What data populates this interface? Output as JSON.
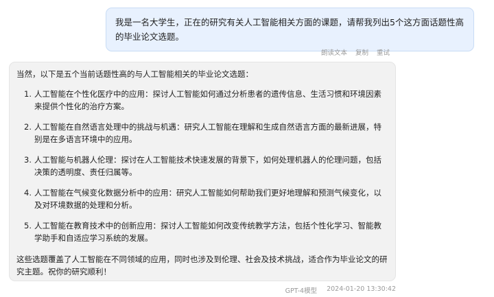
{
  "user_message": {
    "text": "我是一名大学生，正在的研究有关人工智能相关方面的课题，请帮我列出5个这方面话题性高的毕业论文选题。",
    "actions": [
      "朗读文本",
      "复制",
      "重试"
    ]
  },
  "ai_message": {
    "intro": "当然，以下是五个当前话题性高的与人工智能相关的毕业论文选题：",
    "items": [
      {
        "num": "1.",
        "text": "人工智能在个性化医疗中的应用：探讨人工智能如何通过分析患者的遗传信息、生活习惯和环境因素来提供个性化的治疗方案。"
      },
      {
        "num": "2.",
        "text": "人工智能在自然语言处理中的挑战与机遇：研究人工智能在理解和生成自然语言方面的最新进展，特别是在多语言环境中的应用。"
      },
      {
        "num": "3.",
        "text": "人工智能与机器人伦理：探讨在人工智能技术快速发展的背景下，如何处理机器人的伦理问题，包括决策的透明度、责任归属等。"
      },
      {
        "num": "4.",
        "text": "人工智能在气候变化数据分析中的应用：研究人工智能如何帮助我们更好地理解和预测气候变化，以及对环境数据的处理和分析。"
      },
      {
        "num": "5.",
        "text": "人工智能在教育技术中的创新应用：探讨人工智能如何改变传统教学方法，包括个性化学习、智能教学助手和自适应学习系统的发展。"
      }
    ],
    "outro": "这些选题覆盖了人工智能在不同领域的应用，同时也涉及到伦理、社会及技术挑战，适合作为毕业论文的研究主题。祝你的研究顺利！",
    "model": "GPT-4模型",
    "timestamp": "2024-01-20 13:30:42"
  }
}
